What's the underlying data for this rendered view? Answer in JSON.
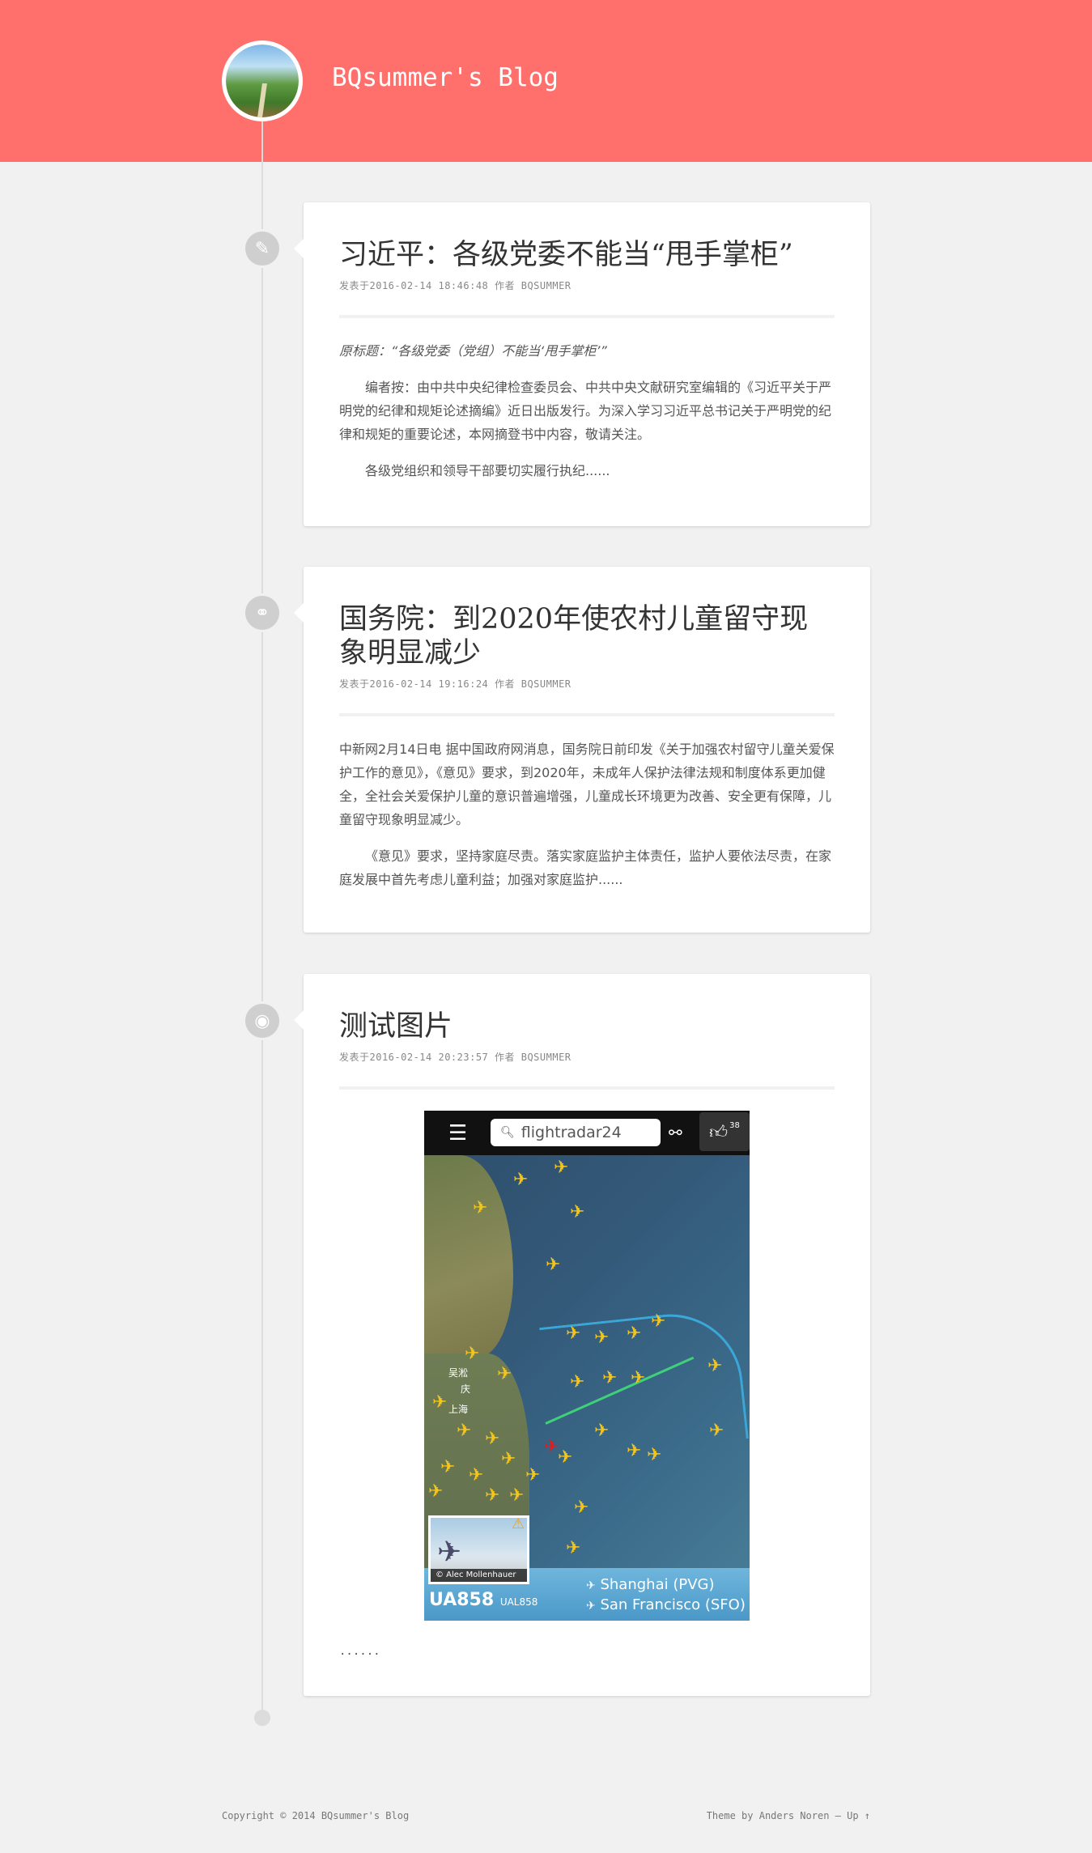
{
  "header": {
    "site_title": "BQsummer's Blog",
    "background_color": "#ff706c"
  },
  "posts": [
    {
      "icon": "pencil-icon",
      "title": "习近平：各级党委不能当“甩手掌柜”",
      "meta": "发表于2016-02-14 18:46:48 作者 BQSUMMER",
      "paragraphs": [
        "原标题：“各级党委（党组）不能当‘甩手掌柜’”",
        "编者按：由中共中央纪律检查委员会、中共中央文献研究室编辑的《习近平关于严明党的纪律和规矩论述摘编》近日出版发行。为深入学习习近平总书记关于严明党的纪律和规矩的重要论述，本网摘登书中内容，敬请关注。",
        "各级党组织和领导干部要切实履行执纪......"
      ]
    },
    {
      "icon": "link-icon",
      "title": "国务院：到2020年使农村儿童留守现象明显减少",
      "meta": "发表于2016-02-14 19:16:24 作者 BQSUMMER",
      "paragraphs": [
        "中新网2月14日电 据中国政府网消息，国务院日前印发《关于加强农村留守儿童关爱保护工作的意见》，《意见》要求，到2020年，未成年人保护法律法规和制度体系更加健全，全社会关爱保护儿童的意识普遍增强，儿童成长环境更为改善、安全更有保障，儿童留守现象明显减少。",
        "《意见》要求，坚持家庭尽责。落实家庭监护主体责任，监护人要依法尽责，在家庭发展中首先考虑儿童利益；加强对家庭监护......"
      ]
    },
    {
      "icon": "camera-icon",
      "title": "测试图片",
      "meta": "发表于2016-02-14 20:23:57 作者 BQSUMMER",
      "image": {
        "search_text": "flightradar24",
        "like_count": "38",
        "city_labels": [
          "吴淞",
          "庆",
          "上海"
        ],
        "photo_credit": "© Alec Mollenhauer",
        "flight_code": "UA858",
        "flight_code_small": "UAL858",
        "from": "Shanghai (PVG)",
        "to": "San Francisco (SFO)"
      },
      "excerpt": "......"
    }
  ],
  "footer": {
    "copyright": "Copyright © 2014 BQsummer's Blog",
    "theme": "Theme by Anders Noren — Up ↑"
  }
}
